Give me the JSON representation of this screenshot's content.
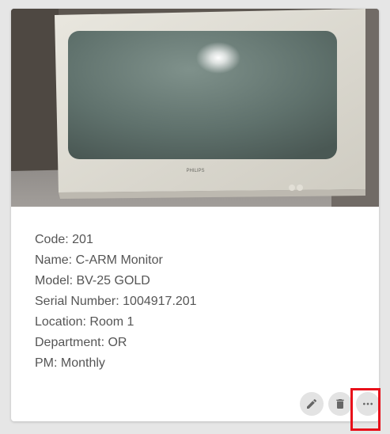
{
  "equipment": {
    "image_alt": "Photo of a Philips CRT monitor",
    "brand_text": "PHILIPS",
    "code": "Code: 201",
    "name": "Name: C-ARM Monitor",
    "model": "Model: BV-25 GOLD",
    "serial_number": "Serial Number: 1004917.201",
    "location": "Location: Room 1",
    "department": "Department: OR",
    "pm": "PM: Monthly"
  },
  "actions": {
    "edit": {
      "icon": "pencil-icon",
      "title": "Edit"
    },
    "delete": {
      "icon": "trash-icon",
      "title": "Delete"
    },
    "more": {
      "icon": "more-horizontal-icon",
      "title": "More"
    }
  },
  "colors": {
    "background": "#e6e6e6",
    "card": "#ffffff",
    "text": "#555555",
    "icon_button": "#e3e3e3",
    "icon": "#666666",
    "highlight": "#e8101a"
  }
}
